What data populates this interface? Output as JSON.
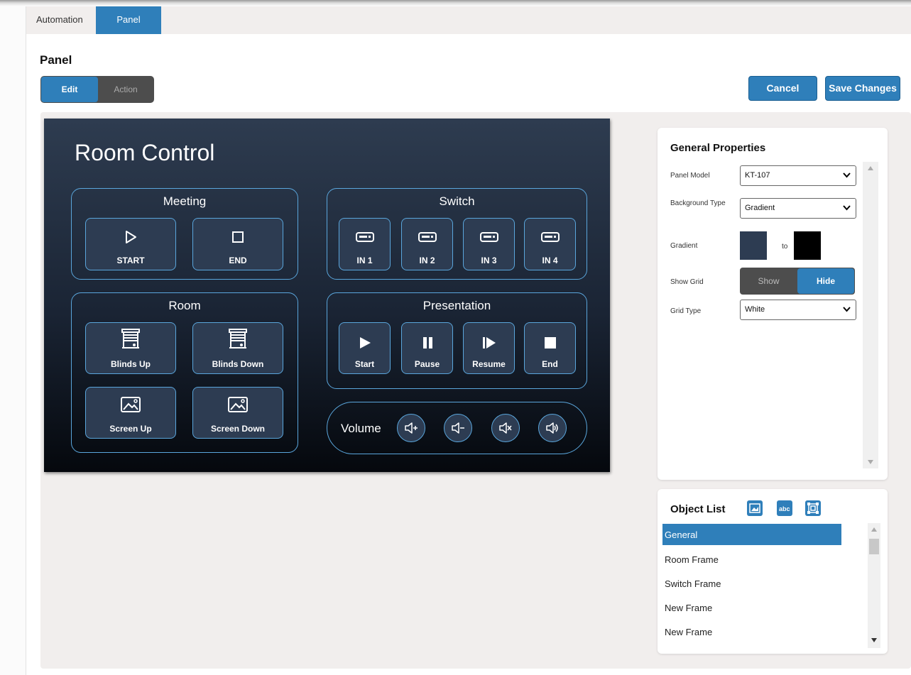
{
  "tabs": {
    "automation": "Automation",
    "panel": "Panel"
  },
  "page": {
    "title": "Panel"
  },
  "mode": {
    "edit": "Edit",
    "action": "Action"
  },
  "actions": {
    "cancel": "Cancel",
    "save": "Save Changes"
  },
  "panel": {
    "title": "Room Control",
    "meeting": {
      "title": "Meeting",
      "start": "START",
      "end": "END"
    },
    "switch": {
      "title": "Switch",
      "inputs": [
        "IN 1",
        "IN 2",
        "IN 3",
        "IN 4"
      ]
    },
    "room": {
      "title": "Room",
      "blinds_up": "Blinds Up",
      "blinds_down": "Blinds Down",
      "screen_up": "Screen Up",
      "screen_down": "Screen Down"
    },
    "presentation": {
      "title": "Presentation",
      "start": "Start",
      "pause": "Pause",
      "resume": "Resume",
      "end": "End"
    },
    "volume": {
      "label": "Volume",
      "buttons": [
        "volume-up-icon",
        "volume-down-icon",
        "mute-icon",
        "volume-loud-icon"
      ]
    }
  },
  "properties": {
    "title": "General Properties",
    "panel_model": {
      "label": "Panel Model",
      "value": "KT-107"
    },
    "background_type": {
      "label": "Background Type",
      "value": "Gradient"
    },
    "gradient": {
      "label": "Gradient",
      "to": "to",
      "from_color": "#2d3c52",
      "to_color": "#000000"
    },
    "show_grid": {
      "label": "Show Grid",
      "show": "Show",
      "hide": "Hide",
      "selected": "Hide"
    },
    "grid_type": {
      "label": "Grid Type",
      "value": "White"
    }
  },
  "object_list": {
    "title": "Object List",
    "tools": [
      "image-icon",
      "text-icon",
      "frame-icon"
    ],
    "items": [
      "General",
      "Room Frame",
      "Switch Frame",
      "New Frame",
      "New Frame"
    ],
    "selected": "General"
  },
  "colors": {
    "accent": "#2f7fba",
    "frame_border": "#5aa6dc",
    "panel_button": "#2d3c52"
  }
}
